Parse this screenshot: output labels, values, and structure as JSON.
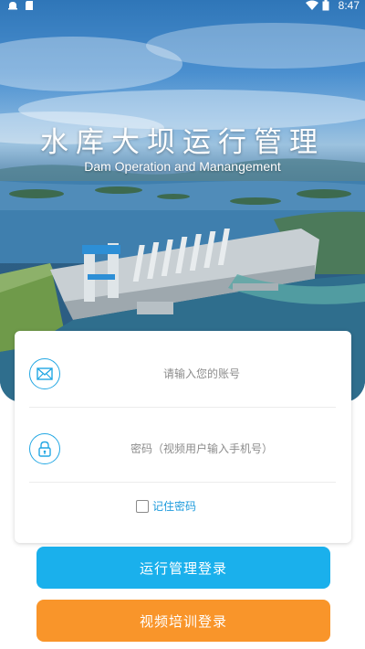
{
  "status_bar": {
    "time": "8:47",
    "left_icons": [
      "notification-icon",
      "sd-card-icon"
    ],
    "right_icons": [
      "wifi-icon",
      "battery-icon"
    ]
  },
  "hero": {
    "title_cn": "水库大坝运行管理",
    "title_en": "Dam Operation and Manangement"
  },
  "login": {
    "account_placeholder": "请输入您的账号",
    "account_value": "",
    "account_icon": "mail-icon",
    "password_placeholder": "密码（视频用户输入手机号）",
    "password_value": "",
    "password_icon": "lock-icon",
    "remember_label": "记住密码",
    "remember_checked": false
  },
  "buttons": {
    "operation_login": "运行管理登录",
    "video_login": "视频培训登录"
  },
  "colors": {
    "accent_blue": "#1ab0ec",
    "accent_orange": "#f9952a",
    "icon_blue": "#22a7e3"
  }
}
